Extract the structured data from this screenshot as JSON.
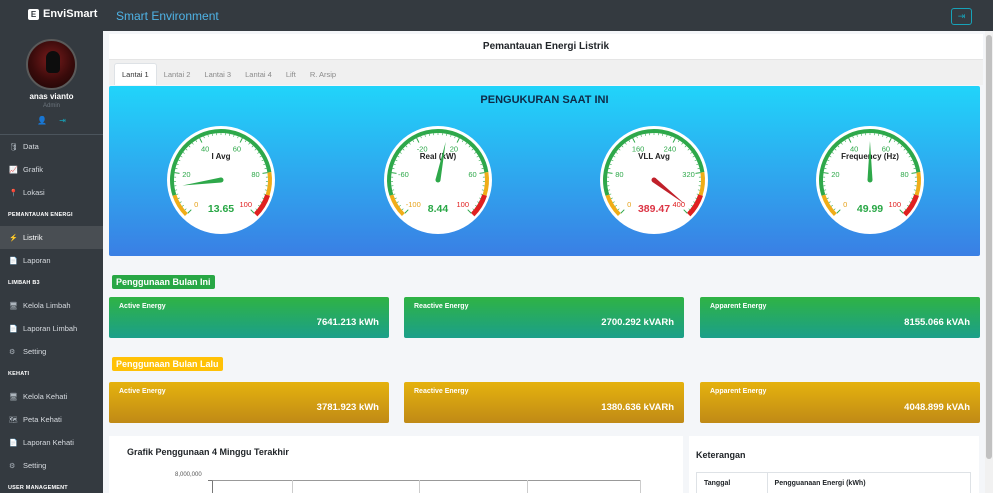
{
  "topbar": {
    "brand": "EnviSmart",
    "title": "Smart Environment"
  },
  "profile": {
    "name": "anas vianto",
    "role": "Admin"
  },
  "sidebar": {
    "items_top": [
      {
        "label": "Data",
        "icon": "database-icon",
        "glyph": "🛢"
      },
      {
        "label": "Grafik",
        "icon": "chart-line-icon",
        "glyph": "📈"
      },
      {
        "label": "Lokasi",
        "icon": "map-pin-icon",
        "glyph": "📍"
      }
    ],
    "header_energy": "PEMANTAUAN ENERGI",
    "items_energy": [
      {
        "label": "Listrik",
        "icon": "bolt-icon",
        "glyph": "⚡",
        "active": true
      },
      {
        "label": "Laporan",
        "icon": "file-icon",
        "glyph": "📄"
      }
    ],
    "header_waste": "LIMBAH B3",
    "items_waste": [
      {
        "label": "Kelola Limbah",
        "icon": "desktop-icon",
        "glyph": "🖥"
      },
      {
        "label": "Laporan Limbah",
        "icon": "file-icon",
        "glyph": "📄"
      },
      {
        "label": "Setting",
        "icon": "gear-icon",
        "glyph": "⚙"
      }
    ],
    "header_kehati": "KEHATI",
    "items_kehati": [
      {
        "label": "Kelola Kehati",
        "icon": "desktop-icon",
        "glyph": "🖥"
      },
      {
        "label": "Peta Kehati",
        "icon": "map-icon",
        "glyph": "🗺"
      },
      {
        "label": "Laporan Kehati",
        "icon": "file-icon",
        "glyph": "📄"
      },
      {
        "label": "Setting",
        "icon": "gear-icon",
        "glyph": "⚙"
      }
    ],
    "header_user": "USER MANAGEMENT"
  },
  "page": {
    "title": "Pemantauan Energi Listrik"
  },
  "tabs": [
    "Lantai 1",
    "Lantai 2",
    "Lantai 3",
    "Lantai 4",
    "Lift",
    "R. Arsip"
  ],
  "gauges": {
    "title": "PENGUKURAN SAAT INI",
    "items": [
      {
        "label": "I Avg",
        "value": "13.65",
        "num": 13.65,
        "min": 0,
        "max": 100,
        "ticks": [
          "0",
          "20",
          "40",
          "60",
          "80",
          "100"
        ],
        "value_color": "#28a745"
      },
      {
        "label": "Real (kW)",
        "value": "8.44",
        "num": 8.44,
        "min": -100,
        "max": 100,
        "ticks": [
          "-100",
          "-60",
          "-20",
          "20",
          "60",
          "100"
        ],
        "value_color": "#28a745"
      },
      {
        "label": "VLL Avg",
        "value": "389.47",
        "num": 389.47,
        "min": 0,
        "max": 400,
        "ticks": [
          "0",
          "80",
          "160",
          "240",
          "320",
          "400"
        ],
        "value_color": "#dc3545"
      },
      {
        "label": "Frequency (Hz)",
        "value": "49.99",
        "num": 49.99,
        "min": 0,
        "max": 100,
        "ticks": [
          "0",
          "20",
          "40",
          "60",
          "80",
          "100"
        ],
        "value_color": "#28a745"
      }
    ]
  },
  "this_month": {
    "label": "Penggunaan Bulan Ini",
    "cards": [
      {
        "label": "Active Energy",
        "value": "7641.213 kWh"
      },
      {
        "label": "Reactive Energy",
        "value": "2700.292 kVARh"
      },
      {
        "label": "Apparent Energy",
        "value": "8155.066 kVAh"
      }
    ]
  },
  "last_month": {
    "label": "Penggunaan Bulan Lalu",
    "cards": [
      {
        "label": "Active Energy",
        "value": "3781.923 kWh"
      },
      {
        "label": "Reactive Energy",
        "value": "1380.636 kVARh"
      },
      {
        "label": "Apparent Energy",
        "value": "4048.899 kVAh"
      }
    ]
  },
  "chart": {
    "title": "Grafik Penggunaan 4 Minggu Terakhir",
    "y_top_tick": "8,000,000"
  },
  "info": {
    "title": "Keterangan",
    "columns": [
      "Tanggal",
      "Pengguanaan Energi (kWh)"
    ]
  },
  "colors": {
    "sidebar_bg": "#343a40",
    "accent": "#17a2b8",
    "title_blue": "#4fb3e6"
  }
}
